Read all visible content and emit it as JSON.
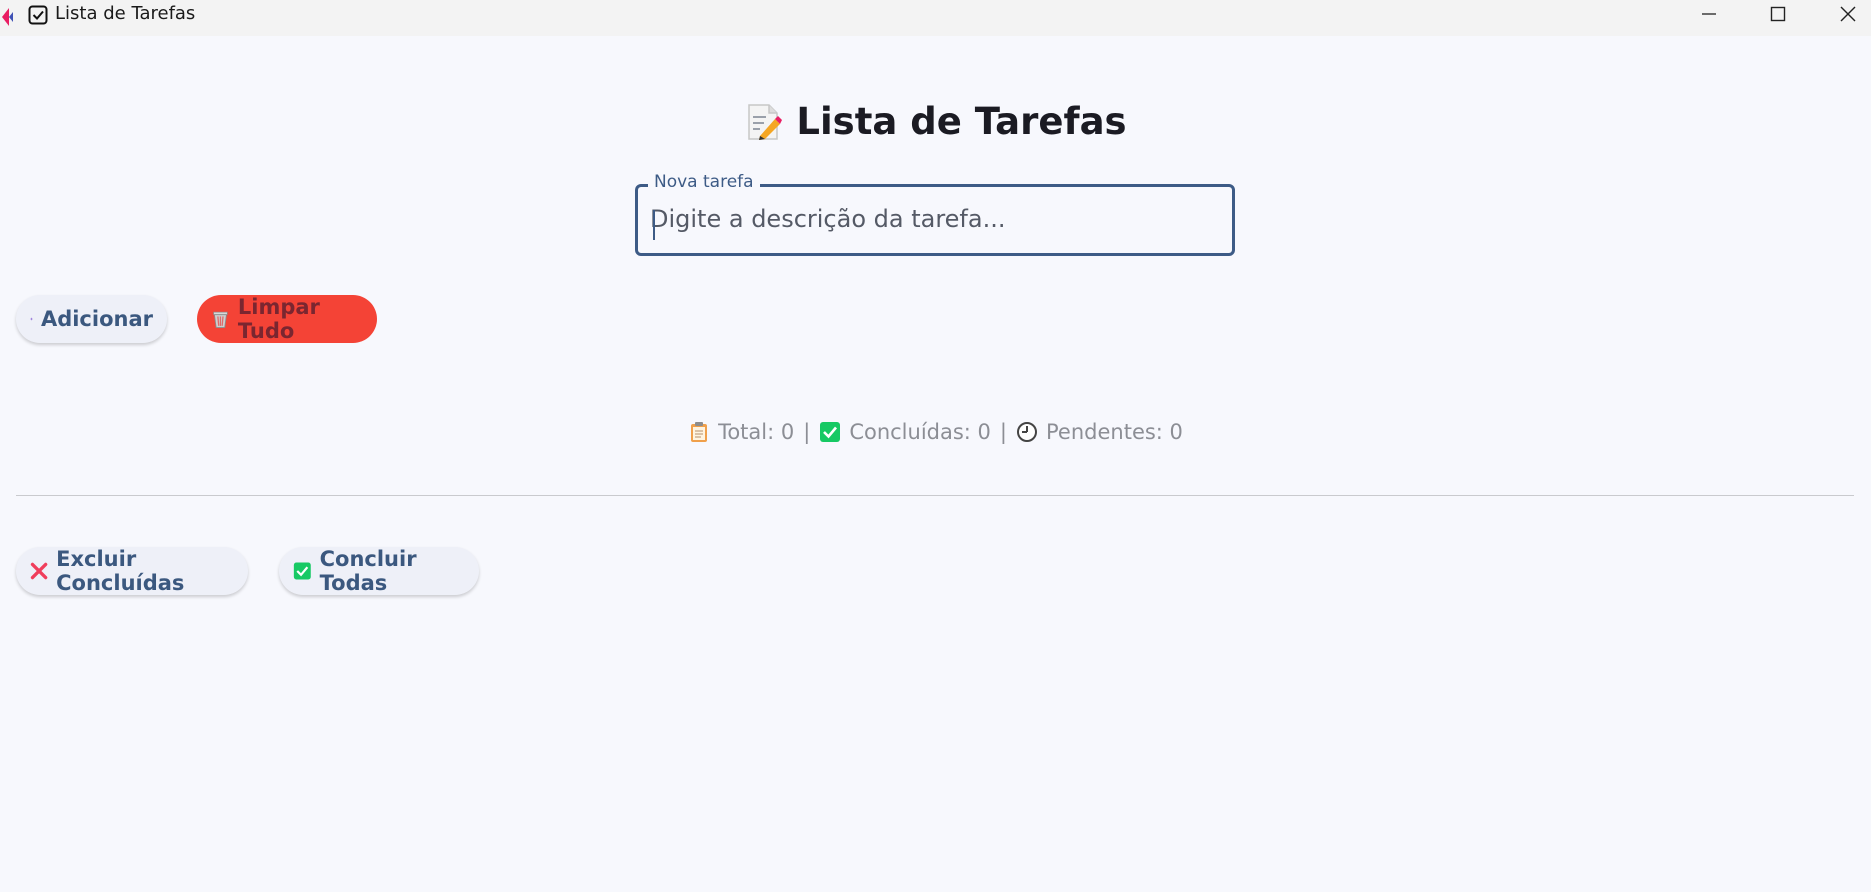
{
  "window": {
    "title": "Lista de Tarefas"
  },
  "header": {
    "title": "Lista de Tarefas"
  },
  "task_input": {
    "label": "Nova tarefa",
    "placeholder": "Digite a descrição da tarefa...",
    "value": ""
  },
  "actions": {
    "add_label": "Adicionar",
    "clear_label": "Limpar Tudo",
    "delete_done_label": "Excluir Concluídas",
    "complete_all_label": "Concluir Todas"
  },
  "stats": {
    "total": "Total: 0",
    "done": "Concluídas: 0",
    "pending": "Pendentes: 0",
    "separator": "|"
  },
  "colors": {
    "accent": "#3d5b86",
    "danger": "#f44336",
    "success": "#17c964",
    "background": "#f7f8fd"
  },
  "icons": {
    "title_bar": "checkbox-icon",
    "heading": "memo-icon",
    "add": "plus-icon",
    "clear": "trash-icon",
    "delete_done": "cross-icon",
    "complete_all": "check-box-icon",
    "total": "clipboard-icon",
    "done": "check-box-icon",
    "pending": "clock-icon"
  }
}
